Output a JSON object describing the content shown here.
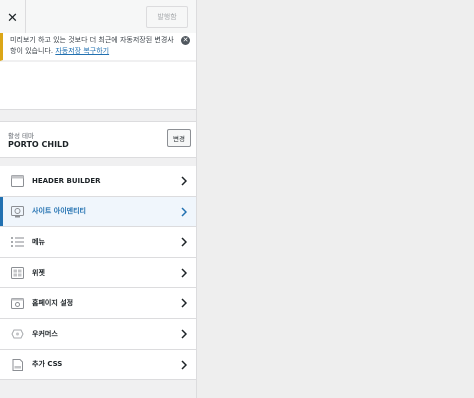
{
  "header": {
    "close_label": "✕",
    "publish_label": "발행함"
  },
  "notice": {
    "text": "미리보기 하고 있는 것보다 더 최근에 자동저장된 변경사항이 있습니다.",
    "link_text": "자동저장 복구하기",
    "close_label": "✕"
  },
  "theme": {
    "label": "활성 테마",
    "name": "PORTO CHILD",
    "change_label": "변경"
  },
  "menu": {
    "items": [
      {
        "label": "HEADER BUILDER",
        "icon": "header-builder-icon",
        "active": false
      },
      {
        "label": "사이트 아이덴티티",
        "icon": "site-identity-icon",
        "active": true
      },
      {
        "label": "메뉴",
        "icon": "menu-icon",
        "active": false
      },
      {
        "label": "위젯",
        "icon": "widgets-icon",
        "active": false
      },
      {
        "label": "홈페이지 설정",
        "icon": "homepage-settings-icon",
        "active": false
      },
      {
        "label": "우커머스",
        "icon": "woocommerce-icon",
        "active": false
      },
      {
        "label": "추가 CSS",
        "icon": "additional-css-icon",
        "active": false
      }
    ]
  },
  "colors": {
    "accent": "#2271b1",
    "notice_border": "#dba617"
  }
}
